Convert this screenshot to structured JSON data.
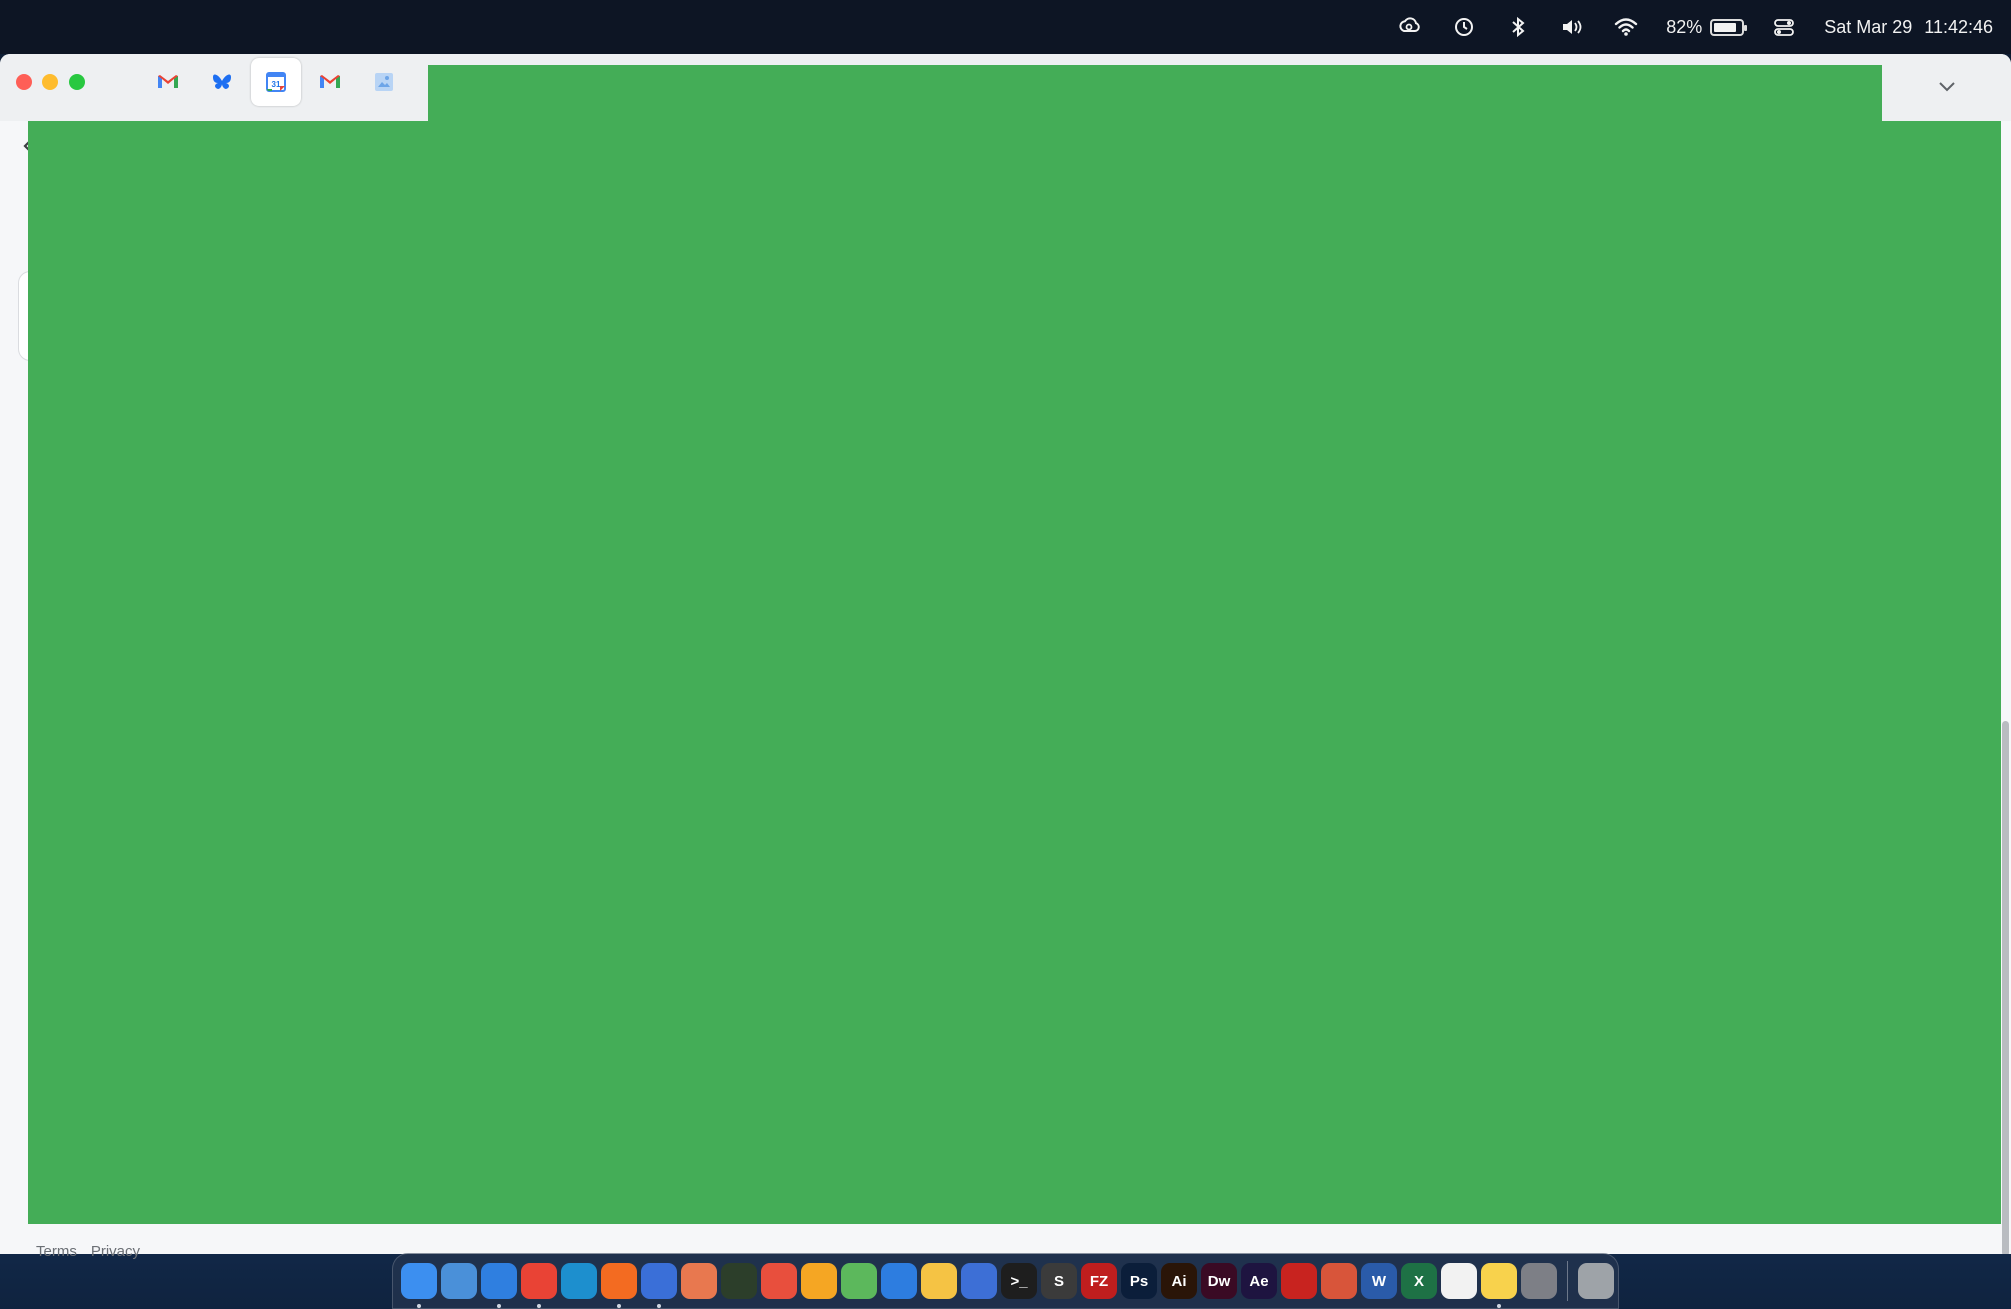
{
  "menubar": {
    "battery_percent": "82%",
    "battery_level": 0.82,
    "date": "Sat Mar 29",
    "time": "11:42:46",
    "icons": [
      "creative-cloud-icon",
      "time-machine-icon",
      "bluetooth-icon",
      "volume-icon",
      "wifi-icon",
      "battery-icon",
      "control-center-icon"
    ]
  },
  "browser": {
    "tabs": [
      {
        "icon": "gmail-icon",
        "active": false
      },
      {
        "icon": "bluesky-icon",
        "active": false
      },
      {
        "icon": "google-calendar-icon",
        "active": true,
        "text": "31"
      },
      {
        "icon": "gmail-icon",
        "active": false
      },
      {
        "icon": "image-icon",
        "active": false
      }
    ]
  },
  "page": {
    "footer": {
      "terms": "Terms",
      "privacy": "Privacy"
    },
    "overlay_color": "#44ad57"
  },
  "dock": {
    "apps": [
      {
        "name": "finder",
        "color": "#3c8ff0",
        "label": "",
        "running": true
      },
      {
        "name": "icloud",
        "color": "#4a90d9",
        "label": "",
        "running": false
      },
      {
        "name": "safari",
        "color": "#2f7fe0",
        "label": "",
        "running": true
      },
      {
        "name": "chrome",
        "color": "#e94335",
        "label": "",
        "running": true
      },
      {
        "name": "edge",
        "color": "#1d8fce",
        "label": "",
        "running": false
      },
      {
        "name": "firefox",
        "color": "#f36b21",
        "label": "",
        "running": true
      },
      {
        "name": "firefox-dev",
        "color": "#3a6fd8",
        "label": "",
        "running": true
      },
      {
        "name": "claude",
        "color": "#e8784f",
        "label": "",
        "running": false
      },
      {
        "name": "app-green",
        "color": "#2c3e2a",
        "label": "",
        "running": false
      },
      {
        "name": "app-red",
        "color": "#e84f3d",
        "label": "",
        "running": false
      },
      {
        "name": "app-orange",
        "color": "#f5a623",
        "label": "",
        "running": false
      },
      {
        "name": "app-green2",
        "color": "#5cb85c",
        "label": "",
        "running": false
      },
      {
        "name": "app-blue",
        "color": "#2d7de0",
        "label": "",
        "running": false
      },
      {
        "name": "google-drive",
        "color": "#f5c344",
        "label": "",
        "running": false
      },
      {
        "name": "app-elephant",
        "color": "#3d6fd6",
        "label": "",
        "running": false
      },
      {
        "name": "terminal",
        "color": "#1e1e1e",
        "label": ">_",
        "running": false
      },
      {
        "name": "sublime",
        "color": "#3b3b3b",
        "label": "S",
        "running": false
      },
      {
        "name": "filezilla",
        "color": "#bf1e1e",
        "label": "FZ",
        "running": false
      },
      {
        "name": "photoshop",
        "color": "#0b1e3a",
        "label": "Ps",
        "running": false
      },
      {
        "name": "illustrator",
        "color": "#2a1508",
        "label": "Ai",
        "running": false
      },
      {
        "name": "dreamweaver",
        "color": "#3a0a24",
        "label": "Dw",
        "running": false
      },
      {
        "name": "after-effects",
        "color": "#1e1440",
        "label": "Ae",
        "running": false
      },
      {
        "name": "acrobat",
        "color": "#c8231f",
        "label": "",
        "running": false
      },
      {
        "name": "app-compass",
        "color": "#d8553a",
        "label": "",
        "running": false
      },
      {
        "name": "word",
        "color": "#2a5ba9",
        "label": "W",
        "running": false
      },
      {
        "name": "excel",
        "color": "#1e7145",
        "label": "X",
        "running": false
      },
      {
        "name": "reminders",
        "color": "#f2f2f2",
        "label": "",
        "running": false
      },
      {
        "name": "notes",
        "color": "#f8d24c",
        "label": "",
        "running": true
      },
      {
        "name": "system-settings",
        "color": "#7d7f86",
        "label": "",
        "running": false
      }
    ],
    "trash": {
      "name": "trash",
      "color": "#9ea3a8"
    }
  }
}
